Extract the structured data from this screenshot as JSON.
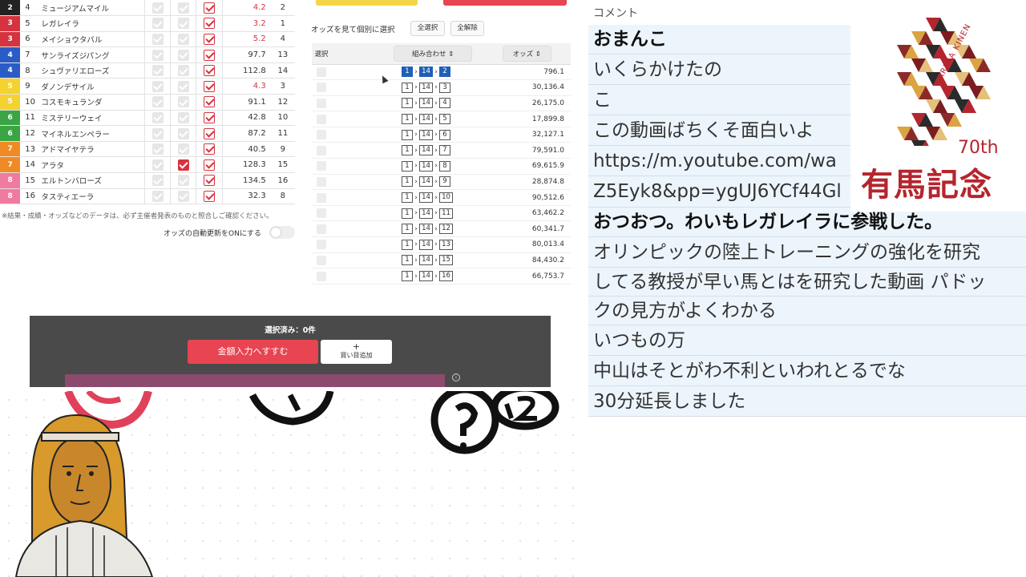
{
  "horses": [
    {
      "frame": "2",
      "frame_bg": "#222222",
      "frame_fg": "#ffffff",
      "num": "4",
      "name": "ミュージアムマイル",
      "odds": "4.2",
      "odds_popular": true,
      "rank": "2",
      "sel2": false
    },
    {
      "frame": "3",
      "frame_bg": "#d6333f",
      "frame_fg": "#ffffff",
      "num": "5",
      "name": "レガレイラ",
      "odds": "3.2",
      "odds_popular": true,
      "rank": "1",
      "sel2": false
    },
    {
      "frame": "3",
      "frame_bg": "#d6333f",
      "frame_fg": "#ffffff",
      "num": "6",
      "name": "メイショウタバル",
      "odds": "5.2",
      "odds_popular": true,
      "rank": "4",
      "sel2": false
    },
    {
      "frame": "4",
      "frame_bg": "#2a5cc8",
      "frame_fg": "#ffffff",
      "num": "7",
      "name": "サンライズジパング",
      "odds": "97.7",
      "odds_popular": false,
      "rank": "13",
      "sel2": false
    },
    {
      "frame": "4",
      "frame_bg": "#2a5cc8",
      "frame_fg": "#ffffff",
      "num": "8",
      "name": "シュヴァリエローズ",
      "odds": "112.8",
      "odds_popular": false,
      "rank": "14",
      "sel2": false
    },
    {
      "frame": "5",
      "frame_bg": "#f4d22f",
      "frame_fg": "#ffffff",
      "num": "9",
      "name": "ダノンデサイル",
      "odds": "4.3",
      "odds_popular": true,
      "rank": "3",
      "sel2": false
    },
    {
      "frame": "5",
      "frame_bg": "#f4d22f",
      "frame_fg": "#ffffff",
      "num": "10",
      "name": "コスモキュランダ",
      "odds": "91.1",
      "odds_popular": false,
      "rank": "12",
      "sel2": false
    },
    {
      "frame": "6",
      "frame_bg": "#3aa544",
      "frame_fg": "#ffffff",
      "num": "11",
      "name": "ミステリーウェイ",
      "odds": "42.8",
      "odds_popular": false,
      "rank": "10",
      "sel2": false
    },
    {
      "frame": "6",
      "frame_bg": "#3aa544",
      "frame_fg": "#ffffff",
      "num": "12",
      "name": "マイネルエンペラー",
      "odds": "87.2",
      "odds_popular": false,
      "rank": "11",
      "sel2": false
    },
    {
      "frame": "7",
      "frame_bg": "#f08a24",
      "frame_fg": "#ffffff",
      "num": "13",
      "name": "アドマイヤテラ",
      "odds": "40.5",
      "odds_popular": false,
      "rank": "9",
      "sel2": false
    },
    {
      "frame": "7",
      "frame_bg": "#f08a24",
      "frame_fg": "#ffffff",
      "num": "14",
      "name": "アラタ",
      "odds": "128.3",
      "odds_popular": false,
      "rank": "15",
      "sel2": true
    },
    {
      "frame": "8",
      "frame_bg": "#f07aa0",
      "frame_fg": "#ffffff",
      "num": "15",
      "name": "エルトンバローズ",
      "odds": "134.5",
      "odds_popular": false,
      "rank": "16",
      "sel2": false
    },
    {
      "frame": "8",
      "frame_bg": "#f07aa0",
      "frame_fg": "#ffffff",
      "num": "16",
      "name": "タスティエーラ",
      "odds": "32.3",
      "odds_popular": false,
      "rank": "8",
      "sel2": false
    }
  ],
  "disclaimer": "※結果・成績・オッズなどのデータは、必ず主催者発表のものと照合しご確認ください。",
  "auto_update_label": "オッズの自動更新をONにする",
  "odds_panel": {
    "title": "オッズを見て個別に選択",
    "select_all": "全選択",
    "clear_all": "全解除",
    "col_select": "選択",
    "col_combo": "組み合わせ",
    "col_odds": "オッズ",
    "sort_icon": "⇕"
  },
  "combos": [
    {
      "a": "1",
      "b": "14",
      "c": "2",
      "odds": "796.1",
      "highlight": true
    },
    {
      "a": "1",
      "b": "14",
      "c": "3",
      "odds": "30,136.4",
      "highlight": false
    },
    {
      "a": "1",
      "b": "14",
      "c": "4",
      "odds": "26,175.0",
      "highlight": false
    },
    {
      "a": "1",
      "b": "14",
      "c": "5",
      "odds": "17,899.8",
      "highlight": false
    },
    {
      "a": "1",
      "b": "14",
      "c": "6",
      "odds": "32,127.1",
      "highlight": false
    },
    {
      "a": "1",
      "b": "14",
      "c": "7",
      "odds": "79,591.0",
      "highlight": false
    },
    {
      "a": "1",
      "b": "14",
      "c": "8",
      "odds": "69,615.9",
      "highlight": false
    },
    {
      "a": "1",
      "b": "14",
      "c": "9",
      "odds": "28,874.8",
      "highlight": false
    },
    {
      "a": "1",
      "b": "14",
      "c": "10",
      "odds": "90,512.6",
      "highlight": false
    },
    {
      "a": "1",
      "b": "14",
      "c": "11",
      "odds": "63,462.2",
      "highlight": false
    },
    {
      "a": "1",
      "b": "14",
      "c": "12",
      "odds": "60,341.7",
      "highlight": false
    },
    {
      "a": "1",
      "b": "14",
      "c": "13",
      "odds": "80,013.4",
      "highlight": false
    },
    {
      "a": "1",
      "b": "14",
      "c": "15",
      "odds": "84,430.2",
      "highlight": false
    },
    {
      "a": "1",
      "b": "14",
      "c": "16",
      "odds": "66,753.7",
      "highlight": false
    }
  ],
  "selection_bar": {
    "count_text": "選択済み：0件",
    "amount_button": "金額入力へすすむ",
    "add_plus": "+",
    "add_button": "買い目追加",
    "info_icon": "i"
  },
  "comments": {
    "header": "コメント",
    "items": [
      {
        "text": "おまんこ",
        "bold": true
      },
      {
        "text": "いくらかけたの",
        "bold": false
      },
      {
        "text": "こ",
        "bold": false
      },
      {
        "text": "この動画ばちくそ面白いよ",
        "bold": false
      },
      {
        "text": "https://m.youtube.com/wa",
        "bold": false
      },
      {
        "text": "Z5Eyk8&pp=ygUJ6YCf44Gl",
        "bold": false
      },
      {
        "text": "おつおつ。わいもレガレイラに参戦した。",
        "bold": true
      },
      {
        "text": "オリンピックの陸上トレーニングの強化を研究",
        "bold": false
      },
      {
        "text": "してる教授が早い馬とはを研究した動画 パドッ",
        "bold": false
      },
      {
        "text": "クの見方がよくわかる",
        "bold": false
      },
      {
        "text": "いつもの万",
        "bold": false
      },
      {
        "text": "中山はそとがわ不利といわれとるでな",
        "bold": false
      },
      {
        "text": "30分延長しました",
        "bold": false
      }
    ]
  },
  "logo": {
    "year": "70th",
    "kanji": "有馬記念",
    "latin": "ARIMA KINEN"
  }
}
